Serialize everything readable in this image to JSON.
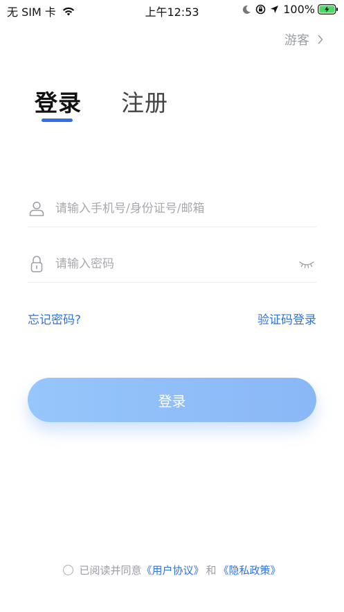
{
  "status_bar": {
    "carrier": "无 SIM 卡",
    "time": "上午12:53",
    "battery": "100%"
  },
  "guest": {
    "label": "游客"
  },
  "tabs": {
    "login": "登录",
    "register": "注册"
  },
  "phone_field": {
    "placeholder": "请输入手机号/身份证号/邮箱"
  },
  "password_field": {
    "placeholder": "请输入密码"
  },
  "links": {
    "forgot_password": "忘记密码?",
    "code_login": "验证码登录"
  },
  "login_button": {
    "label": "登录"
  },
  "agreement": {
    "prefix": "已阅读并同意",
    "user_agreement": "《用户协议》",
    "and": "和",
    "privacy_policy": "《隐私政策》"
  },
  "colors": {
    "accent": "#2f73e0",
    "button_gradient_start": "#96c6fb",
    "button_gradient_end": "#8ab7f6",
    "placeholder": "#a7a9ae"
  },
  "icons": {
    "wifi": "wifi-icon",
    "moon": "moon-icon",
    "orientation_lock": "orientation-lock-icon",
    "location": "location-arrow-icon",
    "battery": "battery-charging-icon",
    "guest_chevron": "chevron-right-icon",
    "user": "user-icon",
    "lock": "lock-icon",
    "eye_closed": "eye-closed-icon"
  }
}
